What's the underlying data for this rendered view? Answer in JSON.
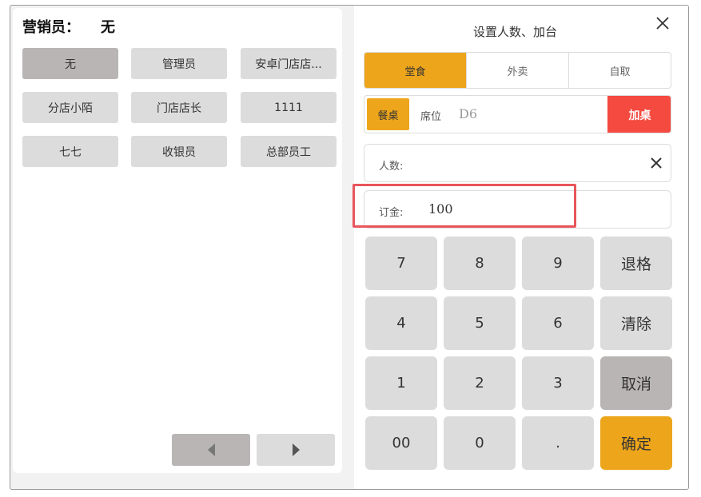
{
  "left": {
    "marketer_label": "营销员：",
    "marketer_value": "无",
    "staff": [
      "无",
      "管理员",
      "安卓门店店...",
      "分店小陌",
      "门店店长",
      "1111",
      "七七",
      "收银员",
      "总部员工"
    ],
    "selected_staff": "无"
  },
  "right": {
    "title": "设置人数、加台",
    "tabs": [
      "堂食",
      "外卖",
      "自取"
    ],
    "active_tab": "堂食",
    "table_tag": "餐桌",
    "seat_label": "席位",
    "seat_value": "D6",
    "add_table": "加桌",
    "people_label": "人数:",
    "people_value": "",
    "deposit_label": "订金:",
    "deposit_value": "100"
  },
  "keypad": {
    "keys": [
      "7",
      "8",
      "9",
      "退格",
      "4",
      "5",
      "6",
      "清除",
      "1",
      "2",
      "3",
      "取消",
      "00",
      "0",
      ".",
      "确定"
    ]
  },
  "colors": {
    "accent": "#eda51b",
    "danger": "#f44a3f",
    "highlight": "#e8565b",
    "key_bg": "#dcdcdc",
    "key_selected_bg": "#b9b5b5"
  },
  "icons": {
    "close": "close-icon",
    "pager_prev": "triangle-left-icon",
    "pager_next": "triangle-right-icon",
    "clear_field": "close-icon"
  }
}
